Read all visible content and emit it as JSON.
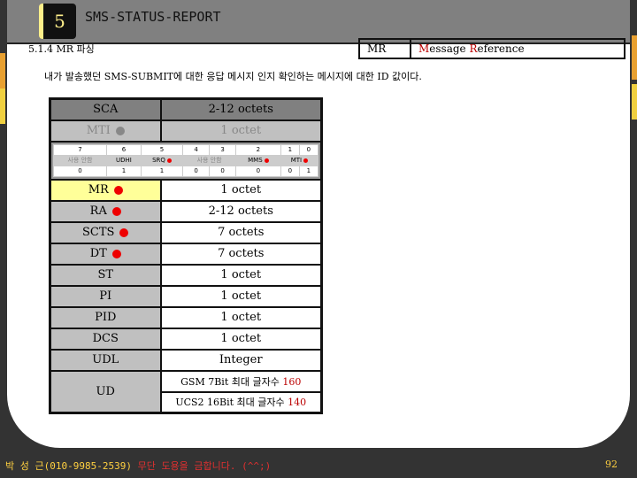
{
  "header": {
    "number": "5",
    "title": "SMS-STATUS-REPORT"
  },
  "section": "5.1.4 MR 파싱",
  "mr_box": {
    "key": "MR",
    "value_m": "M",
    "value_1": "essage ",
    "value_r": "R",
    "value_2": "eference"
  },
  "description": "내가 발송했던 SMS-SUBMIT에 대한 응답 메시지 인지 확인하는 메시지에 대한 ID 값이다.",
  "table": {
    "sca": {
      "name": "SCA",
      "size": "2-12 octets"
    },
    "mti": {
      "name": "MTI",
      "size": "1 octet"
    },
    "bits": {
      "positions": [
        "7",
        "6",
        "5",
        "4",
        "3",
        "2",
        "1",
        "0"
      ],
      "labels": [
        "사용 안함",
        "UDHI",
        "SRQ",
        "사용 안함",
        "MMS",
        "MTI"
      ],
      "values": [
        "0",
        "1",
        "1",
        "0",
        "0",
        "0",
        "0",
        "1"
      ]
    },
    "rows": [
      {
        "name": "MR",
        "size": "1 octet"
      },
      {
        "name": "RA",
        "size": "2-12 octets"
      },
      {
        "name": "SCTS",
        "size": "7 octets"
      },
      {
        "name": "DT",
        "size": "7 octets"
      },
      {
        "name": "ST",
        "size": "1 octet"
      },
      {
        "name": "PI",
        "size": "1 octet"
      },
      {
        "name": "PID",
        "size": "1 octet"
      },
      {
        "name": "DCS",
        "size": "1 octet"
      },
      {
        "name": "UDL",
        "size": "Integer"
      }
    ],
    "ud": {
      "name": "UD",
      "gsm": "GSM 7Bit 최대 글자수 ",
      "gsm_n": "160",
      "ucs": "UCS2 16Bit 최대 글자수 ",
      "ucs_n": "140"
    }
  },
  "footer": {
    "author": "박 성 근(010-9985-2539) ",
    "notice": "무단 도용을 금합니다. (^^;)",
    "page": "92"
  },
  "colors": {
    "highlight": "#ffff99",
    "marker": "#ee0000",
    "header": "#808080"
  }
}
